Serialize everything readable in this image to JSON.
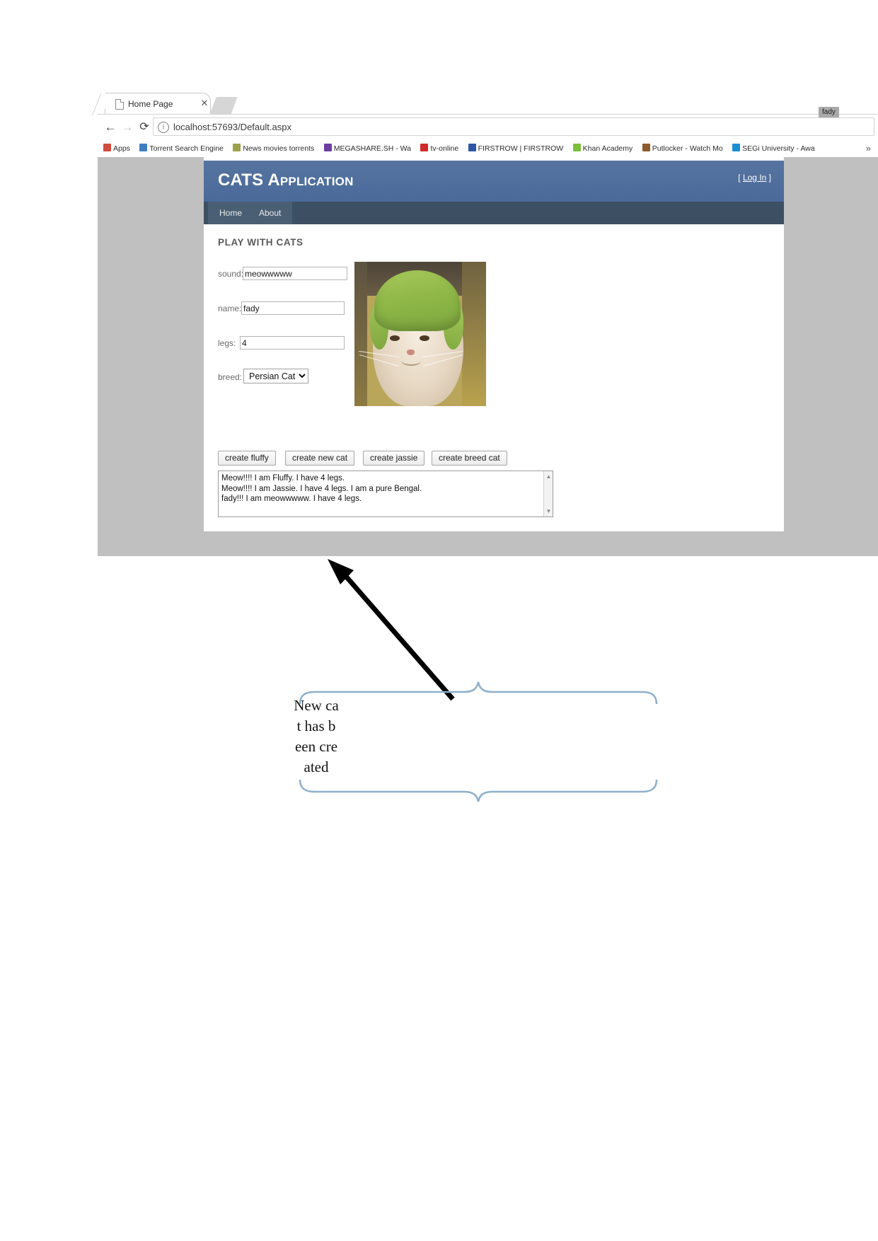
{
  "browser": {
    "tab": {
      "title": "Home Page",
      "page_icon": "page-icon",
      "close_icon": "close-icon"
    },
    "toolbar": {
      "back_icon": "back-arrow-icon",
      "forward_icon": "forward-arrow-icon",
      "reload_icon": "reload-icon",
      "info_icon": "info-circle-icon",
      "url": "localhost:57693/Default.aspx"
    },
    "bookmarks": [
      {
        "label": "Apps",
        "icon": "apps-grid-icon",
        "color": "#cf4b3a"
      },
      {
        "label": "Torrent Search Engine",
        "icon": "torrent-icon",
        "color": "#3f7fbf"
      },
      {
        "label": "News movies torrents",
        "icon": "shield-icon",
        "color": "#9aa24a"
      },
      {
        "label": "MEGASHARE.SH - Wa",
        "icon": "film-icon",
        "color": "#6b3fa0"
      },
      {
        "label": "tv-online",
        "icon": "tv-icon",
        "color": "#cf2b2b"
      },
      {
        "label": "FIRSTROW | FIRSTROW",
        "icon": "ball-icon",
        "color": "#2f55a4"
      },
      {
        "label": "Khan Academy",
        "icon": "leaf-icon",
        "color": "#7dbf3a"
      },
      {
        "label": "Putlocker - Watch Mo",
        "icon": "building-icon",
        "color": "#8c5a2b"
      },
      {
        "label": "SEGi University - Awa",
        "icon": "university-icon",
        "color": "#1a8fd1"
      }
    ],
    "overflow_label": "»",
    "fady_badge": "fady"
  },
  "app": {
    "title": "CATS Application",
    "login_link": {
      "open_bracket": "[",
      "label": "Log In",
      "close_bracket": "]"
    },
    "nav": [
      {
        "label": "Home",
        "name": "nav-home"
      },
      {
        "label": "About",
        "name": "nav-about"
      }
    ],
    "section_title": "PLAY WITH CATS",
    "fields": [
      {
        "name": "sound",
        "label": "sound:",
        "value": "meowwwww"
      },
      {
        "name": "name",
        "label": "name:",
        "value": "fady"
      },
      {
        "name": "legs",
        "label": "legs:",
        "value": "4"
      }
    ],
    "breed": {
      "label": "breed:",
      "selected": "Persian Cat",
      "options": [
        "Persian Cat"
      ],
      "caret_icon": "chevron-down-icon"
    },
    "buttons": [
      {
        "name": "create-fluffy",
        "label": "create fluffy"
      },
      {
        "name": "create-new-cat",
        "label": "create new cat"
      },
      {
        "name": "create-jassie",
        "label": "create jassie"
      },
      {
        "name": "create-breed-cat",
        "label": "create breed cat"
      }
    ],
    "log": {
      "lines": [
        "Meow!!!! I am Fluffy. I have 4 legs.",
        "Meow!!!! I am Jassie. I have 4 legs. I am a pure Bengal.",
        "fady!!! I am meowwwww. I have 4 legs."
      ],
      "scroll_up_icon": "scroll-up-arrow-icon",
      "scroll_down_icon": "scroll-down-arrow-icon"
    },
    "photo_alt": "cat-wearing-lime-peel-helmet"
  },
  "annotation": {
    "text": "New cat has been created",
    "brace_color": "#8fb0cc",
    "arrow_color": "#000000"
  }
}
